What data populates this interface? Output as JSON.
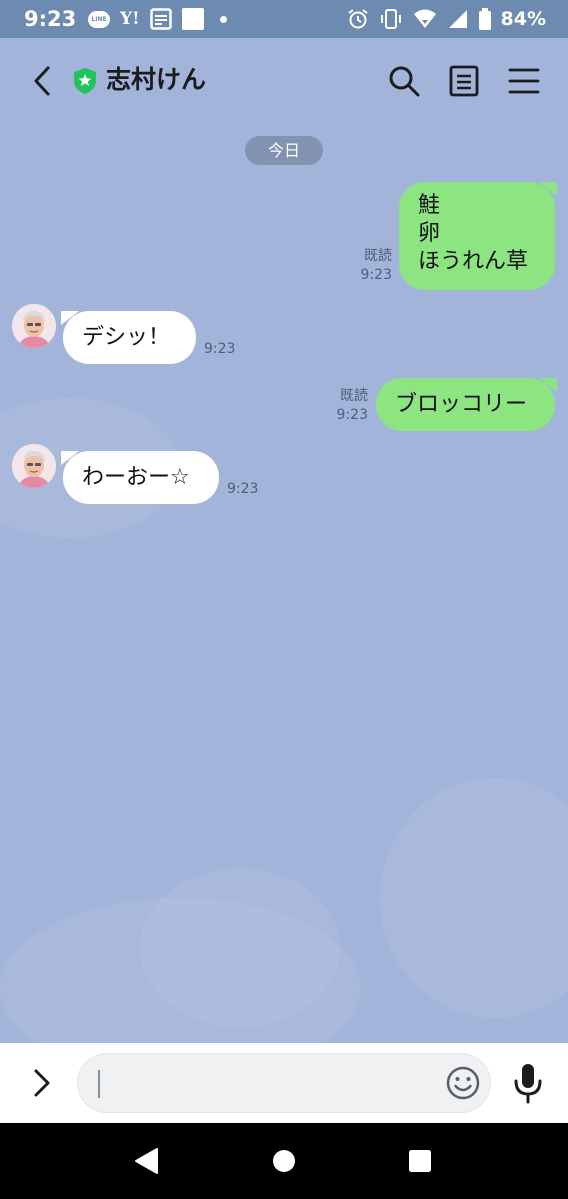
{
  "status_bar": {
    "time": "9:23",
    "battery_percent": "84%",
    "line_app_label": "LINE",
    "yahoo_label": "Y!",
    "icons": [
      "line-notification-icon",
      "yahoo-icon",
      "news-icon",
      "white-square-icon",
      "dot-icon",
      "alarm-icon",
      "vibrate-icon",
      "wifi-icon",
      "signal-icon",
      "battery-icon"
    ]
  },
  "header": {
    "title": "志村けん",
    "icons": [
      "back-icon",
      "official-shield-icon",
      "search-icon",
      "notes-icon",
      "menu-icon"
    ]
  },
  "chat": {
    "date_label": "今日",
    "messages": [
      {
        "direction": "outgoing",
        "lines": [
          "鮭",
          "卵",
          "ほうれん草"
        ],
        "read_label": "既読",
        "time": "9:23"
      },
      {
        "direction": "incoming",
        "text": "デシッ！",
        "time": "9:23"
      },
      {
        "direction": "outgoing",
        "text": "ブロッコリー",
        "read_label": "既読",
        "time": "9:23"
      },
      {
        "direction": "incoming",
        "text": "わーおー☆",
        "time": "9:23"
      }
    ]
  },
  "input_bar": {
    "placeholder": "",
    "value": "",
    "icons": [
      "expand-icon",
      "emoji-icon",
      "microphone-icon"
    ]
  },
  "nav_bar": {
    "icons": [
      "back-triangle-icon",
      "home-circle-icon",
      "recents-square-icon"
    ]
  },
  "colors": {
    "chat_background": "#a2b4d9",
    "status_bar": "#6d8ab0",
    "outgoing_bubble": "#8de581",
    "incoming_bubble": "#ffffff",
    "official_badge": "#22c35c"
  }
}
